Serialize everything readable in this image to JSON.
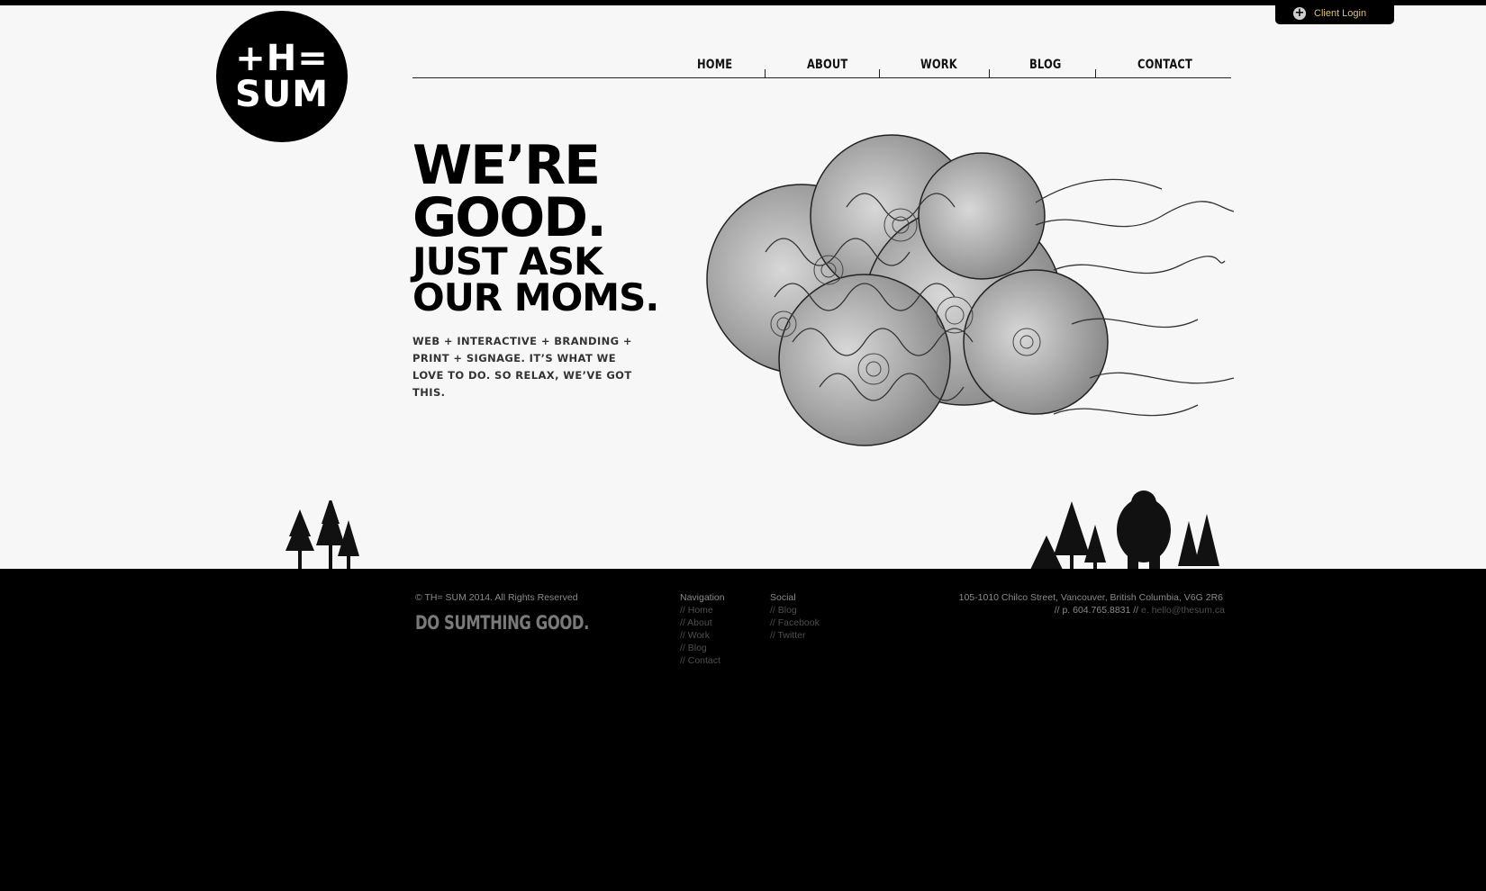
{
  "client_login": {
    "icon": "plus-circle-icon",
    "label": "Client Login"
  },
  "logo": {
    "line1": "+H=",
    "line2": "SUM"
  },
  "nav": {
    "items": [
      {
        "label": "HOME"
      },
      {
        "label": "ABOUT"
      },
      {
        "label": "WORK"
      },
      {
        "label": "BLOG"
      },
      {
        "label": "CONTACT"
      }
    ]
  },
  "hero": {
    "line1": "WE’RE",
    "line2": "GOOD.",
    "line3": "JUST ASK",
    "line4": "OUR MOMS.",
    "tagline": "WEB + INTERACTIVE + BRANDING + PRINT + SIGNAGE. IT’S WHAT WE LOVE TO DO. SO RELAX, WE’VE GOT THIS."
  },
  "footer": {
    "copyright": "© TH= SUM 2014. All Rights Reserved",
    "slogan": "DO SUMTHING GOOD.",
    "navigation": {
      "heading": "Navigation",
      "links": [
        "// Home",
        "// About",
        "// Work",
        "// Blog",
        "// Contact"
      ]
    },
    "social": {
      "heading": "Social",
      "links": [
        "// Blog",
        "// Facebook",
        "// Twitter"
      ]
    },
    "address": "105-1010 Chilco Street, Vancouver, British Columbia, V6G 2R6",
    "phone": "// p. 604.765.8831 //",
    "email": "e. hello@thesum.ca"
  },
  "colors": {
    "accent": "#d9c36e",
    "background": "#f7f7f7",
    "footer": "#000000"
  }
}
